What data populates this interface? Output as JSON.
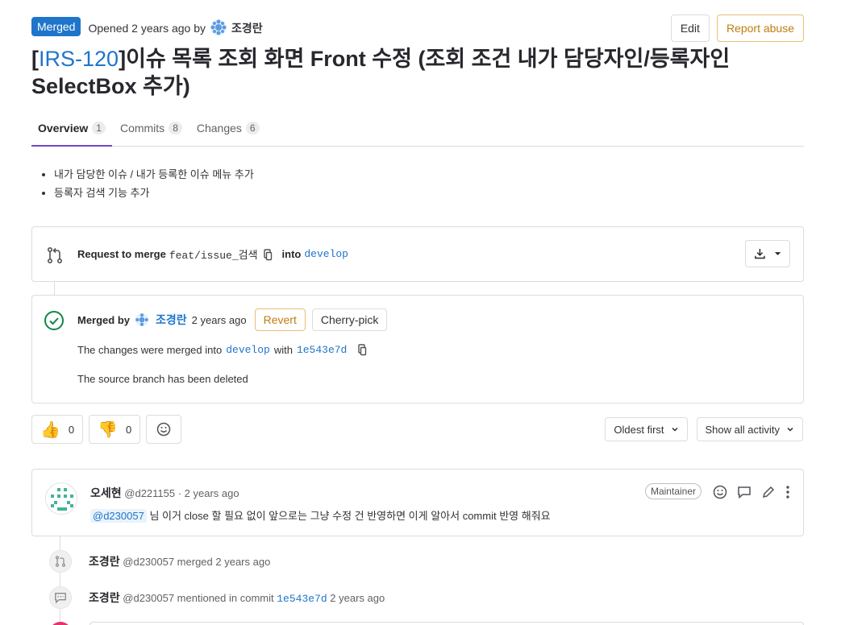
{
  "header": {
    "status_badge": "Merged",
    "opened_text": "Opened 2 years ago by",
    "author": "조경란",
    "edit_label": "Edit",
    "report_label": "Report abuse"
  },
  "title": {
    "ref": "IRS-120",
    "text": "이슈 목록 조회 화면 Front 수정 (조회 조건 내가 담당자인/등록자인 SelectBox 추가)"
  },
  "tabs": [
    {
      "label": "Overview",
      "count": "1"
    },
    {
      "label": "Commits",
      "count": "8"
    },
    {
      "label": "Changes",
      "count": "6"
    }
  ],
  "description": [
    "내가 담당한 이슈 / 내가 등록한 이슈 메뉴 추가",
    "등록자 검색 기능 추가"
  ],
  "merge_request": {
    "label": "Request to merge",
    "source_branch": "feat/issue_검색",
    "into_label": "into",
    "target_branch": "develop"
  },
  "merge_status": {
    "merged_by_label": "Merged by",
    "user": "조경란",
    "time": "2 years ago",
    "revert_label": "Revert",
    "cherry_label": "Cherry-pick",
    "changes_text": "The changes were merged into",
    "branch": "develop",
    "with_label": "with",
    "commit": "1e543e7d",
    "deleted_text": "The source branch has been deleted"
  },
  "reactions": {
    "thumbs_up_count": "0",
    "thumbs_down_count": "0"
  },
  "sort": {
    "order_label": "Oldest first",
    "filter_label": "Show all activity"
  },
  "comment": {
    "author": "오세현",
    "meta": "@d221155 · 2 years ago",
    "role": "Maintainer",
    "mention": "@d230057",
    "body": "님 이거 close 할 필요 없이 앞으로는 그냥 수정 건 반영하면 이게 알아서 commit 반영 해줘요"
  },
  "events": [
    {
      "author": "조경란",
      "text": "@d230057 merged 2 years ago"
    },
    {
      "author": "조경란",
      "text": "@d230057 mentioned in commit",
      "commit": "1e543e7d",
      "time": "2 years ago"
    }
  ],
  "colors": {
    "accent": "#1f75cb",
    "merged_badge": "#1f75cb",
    "success": "#108548",
    "warning_text": "#c17d10",
    "tab_underline": "#6e49cb"
  }
}
